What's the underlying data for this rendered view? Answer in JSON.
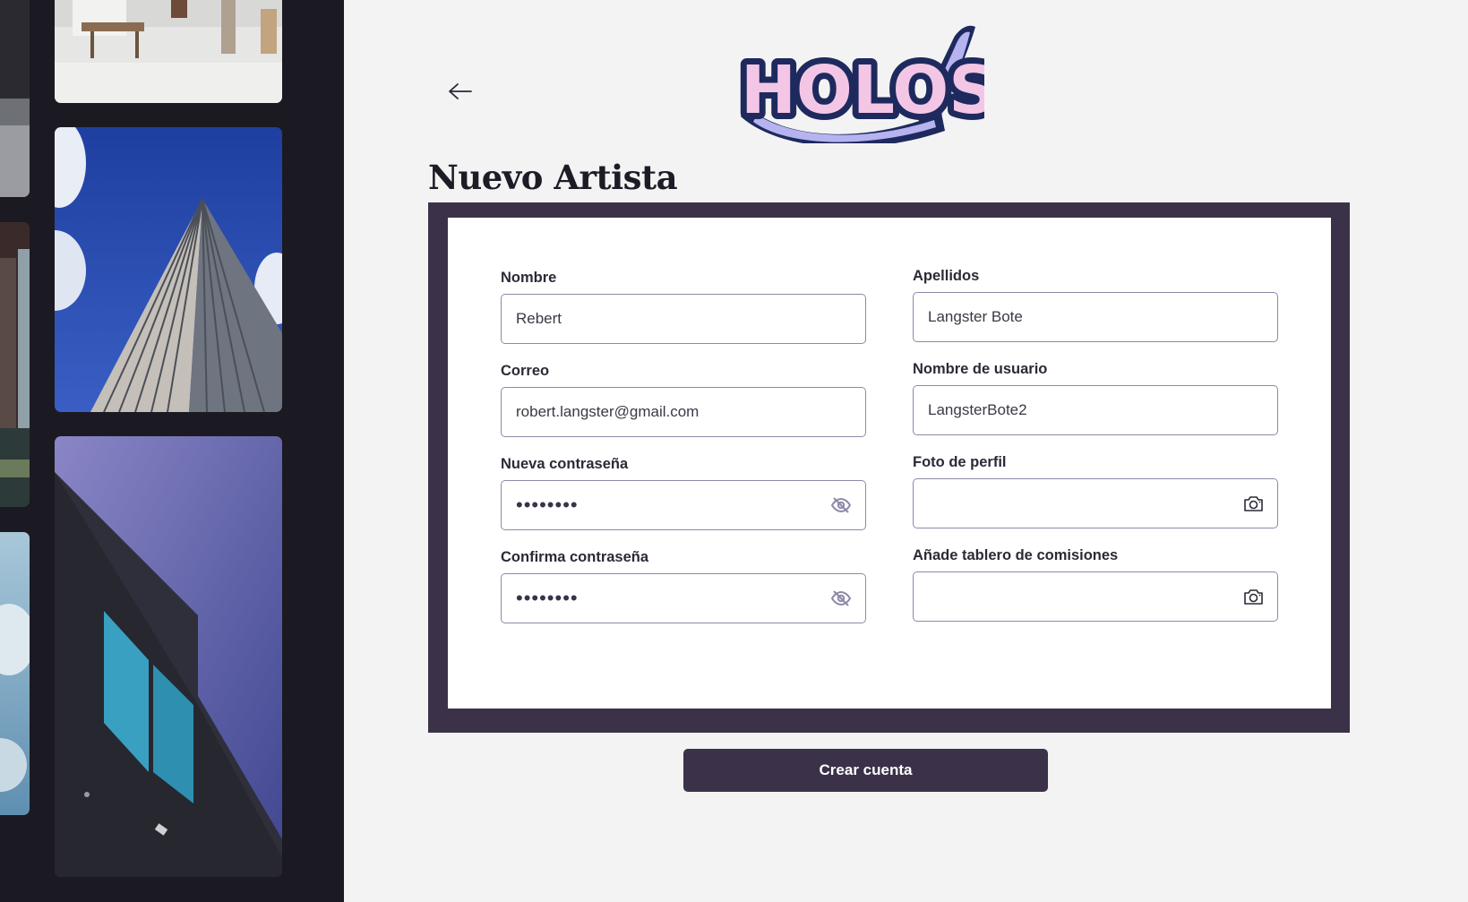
{
  "app": {
    "brand": "HOLOS",
    "back_icon": "arrow-left-icon",
    "accent": "#3b3249",
    "logo_color": "#f4c6e6"
  },
  "page": {
    "title": "Nuevo Artista"
  },
  "form": {
    "nombre": {
      "label": "Nombre",
      "value": "Rebert"
    },
    "apellidos": {
      "label": "Apellidos",
      "value": "Langster Bote"
    },
    "correo": {
      "label": "Correo",
      "value": "robert.langster@gmail.com"
    },
    "usuario": {
      "label": "Nombre de usuario",
      "value": "LangsterBote2"
    },
    "nueva_password": {
      "label": "Nueva contraseña",
      "value": "••••••••",
      "icon": "eye-off-icon"
    },
    "foto_perfil": {
      "label": "Foto de perfil",
      "value": "",
      "icon": "camera-icon"
    },
    "confirma_password": {
      "label": "Confirma contraseña",
      "value": "••••••••",
      "icon": "eye-off-icon"
    },
    "tablero": {
      "label": "Añade tablero de comisiones",
      "value": "",
      "icon": "camera-icon"
    }
  },
  "actions": {
    "create_label": "Crear cuenta"
  }
}
